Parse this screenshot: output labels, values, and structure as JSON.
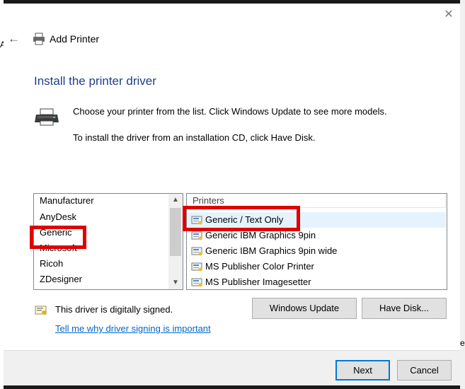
{
  "background": {
    "left_clip_text": "A",
    "right_clip_text": "e"
  },
  "window": {
    "title": "Add Printer",
    "close_glyph": "✕",
    "back_glyph": "←"
  },
  "heading": "Install the printer driver",
  "intro": {
    "line1": "Choose your printer from the list. Click Windows Update to see more models.",
    "line2": "To install the driver from an installation CD, click Have Disk."
  },
  "manufacturer_list": {
    "header": "Manufacturer",
    "items": [
      "AnyDesk",
      "Generic",
      "Microsoft",
      "Ricoh",
      "ZDesigner"
    ],
    "selected": "Generic"
  },
  "printer_list": {
    "header": "Printers",
    "items": [
      "Generic / Text Only",
      "Generic IBM Graphics 9pin",
      "Generic IBM Graphics 9pin wide",
      "MS Publisher Color Printer",
      "MS Publisher Imagesetter"
    ],
    "selected": "Generic / Text Only"
  },
  "signing": {
    "status": "This driver is digitally signed.",
    "link": "Tell me why driver signing is important"
  },
  "buttons": {
    "windows_update": "Windows Update",
    "have_disk": "Have Disk...",
    "next": "Next",
    "cancel": "Cancel"
  },
  "colors": {
    "accent": "#0078d7",
    "heading": "#1e3f8a",
    "highlight": "#e00000",
    "link": "#0066cc"
  },
  "icons": [
    "back-arrow-icon",
    "printer-icon",
    "close-icon",
    "printer-large-icon",
    "printer-driver-icon",
    "certificate-icon",
    "scroll-up-icon",
    "scroll-down-icon"
  ]
}
